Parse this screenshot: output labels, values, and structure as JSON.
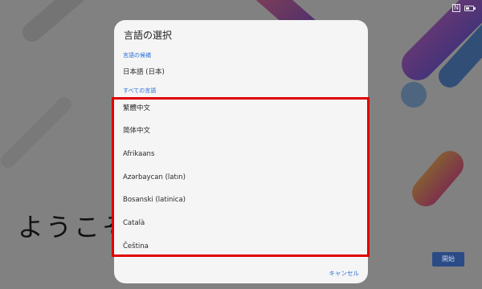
{
  "status_bar": {
    "nfc_icon": "N",
    "battery_icon": "battery-icon"
  },
  "background": {
    "welcome_text": "ようこそ",
    "start_button_label": "開始"
  },
  "dialog": {
    "title": "言語の選択",
    "suggested_header": "言語の候補",
    "suggested_languages": [
      "日本語 (日本)"
    ],
    "all_header": "すべての言語",
    "all_languages": [
      "繁體中文",
      "简体中文",
      "Afrikaans",
      "Azərbaycan (latın)",
      "Bosanski (latinica)",
      "Català",
      "Čeština"
    ],
    "cancel_label": "キャンセル"
  },
  "colors": {
    "accent": "#2a6fd6",
    "highlight": "#e00000",
    "start_button": "#2b4b86"
  }
}
